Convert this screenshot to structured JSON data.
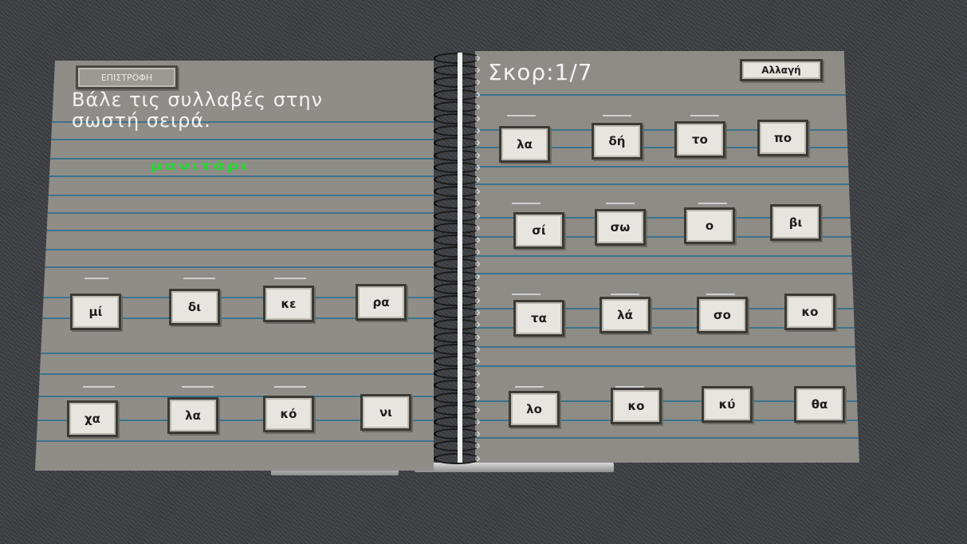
{
  "buttons": {
    "back_label": "ΕΠΙΣΤΡΟΦΗ",
    "change_label": "Αλλαγή"
  },
  "instruction": "Βάλε τις συλλαβές στην\nσωστή σειρά.",
  "answer_text": "μανιτάρι",
  "score": "Σκορ:1/7",
  "left_rows": [
    [
      "μί",
      "δι",
      "κε",
      "ρα"
    ],
    [
      "χα",
      "λα",
      "κό",
      "νι"
    ]
  ],
  "right_rows": [
    [
      "λα",
      "δή",
      "το",
      "πο"
    ],
    [
      "σί",
      "σω",
      "ο",
      "βι"
    ],
    [
      "τα",
      "λά",
      "σο",
      "κο"
    ],
    [
      "λο",
      "κο",
      "κύ",
      "θα"
    ]
  ],
  "colors": {
    "page": "#8f8d87",
    "ruled_line": "#2f6f8e",
    "answer_text": "#2fd13a",
    "tile_bg": "#e7e5df"
  }
}
